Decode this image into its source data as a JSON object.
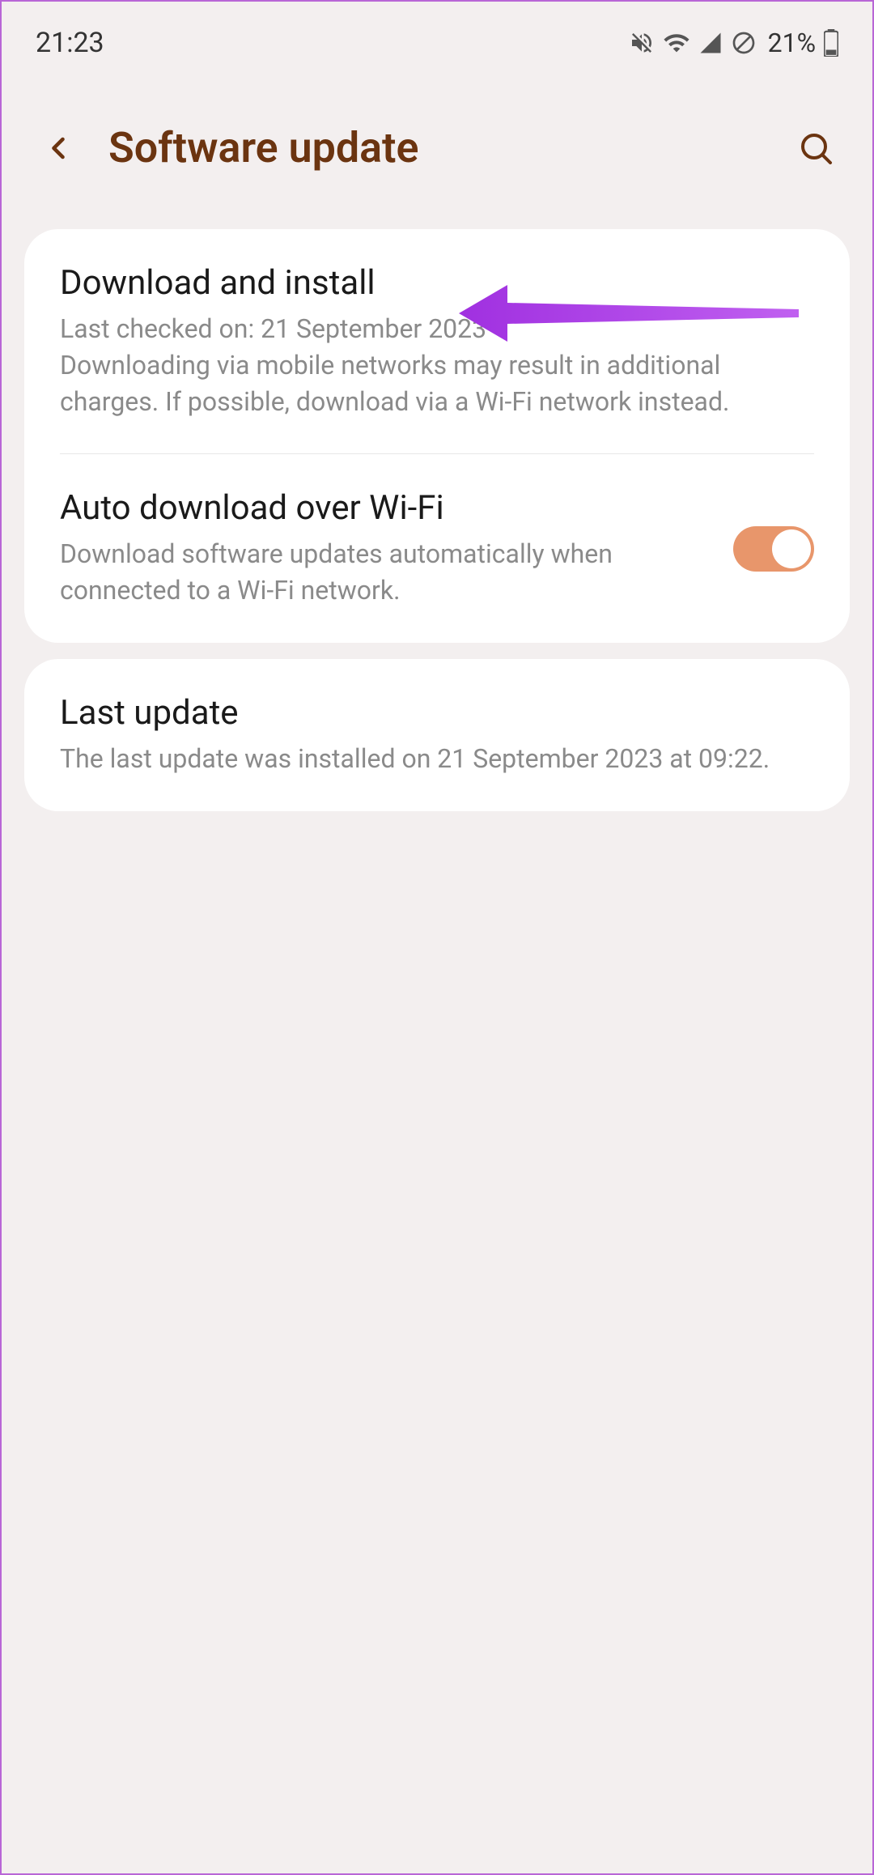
{
  "status": {
    "time": "21:23",
    "battery_percent": "21%"
  },
  "header": {
    "title": "Software update"
  },
  "card1": {
    "item1": {
      "title": "Download and install",
      "subtitle": "Last checked on: 21 September 2023\nDownloading via mobile networks may result in additional charges. If possible, download via a Wi-Fi network instead."
    },
    "item2": {
      "title": "Auto download over Wi-Fi",
      "subtitle": "Download software updates automatically when connected to a Wi-Fi network."
    }
  },
  "card2": {
    "item1": {
      "title": "Last update",
      "subtitle": "The last update was installed on 21 September 2023 at 09:22."
    }
  }
}
